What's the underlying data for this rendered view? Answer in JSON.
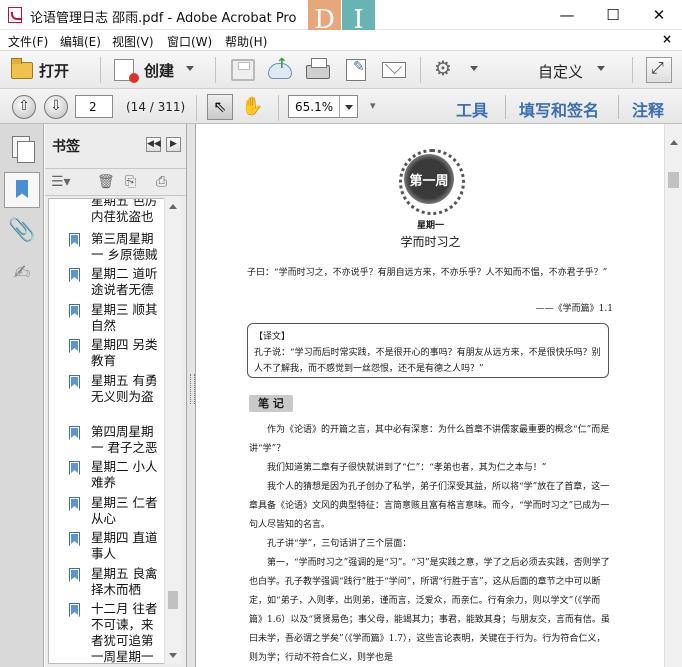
{
  "window": {
    "title": "论语管理日志 邵雨.pdf - Adobe Acrobat Pro",
    "logo_d": "D",
    "logo_i": "I",
    "minimize": "—",
    "maximize": "☐",
    "close": "✕"
  },
  "menu": {
    "items": [
      "文件(F)",
      "编辑(E)",
      "视图(V)",
      "窗口(W)",
      "帮助(H)"
    ],
    "close": "×"
  },
  "toolbar": {
    "open_label": "打开",
    "create_label": "创建",
    "customize_label": "自定义"
  },
  "nav": {
    "page_input": "2",
    "page_count": "(14 / 311)",
    "zoom": "65.1%",
    "more": "▾",
    "pane_tabs": [
      "工具",
      "填写和签名",
      "注释"
    ]
  },
  "bookmarks": {
    "title": "书签",
    "items": [
      "星期五 色厉内荏犹盗也",
      "第三周星期一 乡原德贼",
      "星期二 道听途说者无德",
      "星期三 顺其自然",
      "星期四 另类教育",
      "星期五 有勇无义则为盗",
      "第四周星期一 君子之恶",
      "星期二 小人难养",
      "星期三 仁者从心",
      "星期四 直道事人",
      "星期五 良禽择木而栖",
      "十二月 往者不可谏，来者犹可追第一周星期一"
    ]
  },
  "document": {
    "week_badge": "第一周",
    "day": "星期一",
    "title": "学而时习之",
    "quote": "子曰：“学而时习之，不亦说乎？有朋自远方来，不亦乐乎？人不知而不愠，不亦君子乎？”",
    "source": "——《学而篇》1.1",
    "translation": "【译文】\n孔子说：“学习而后时常实践，不是很开心的事吗？有朋友从远方来，不是很快乐吗？别人不了解我，而不感觉到一丝怨恨，还不是有德之人吗？”",
    "note_tag": "笔 记",
    "body": [
      "作为《论语》的开篇之言，其中必有深意：为什么首章不讲儒家最重要的概念“仁”而是讲“学”？",
      "我们知道第二章有子很快就讲到了“仁”：“孝弟也者，其为仁之本与！”",
      "我个人的猜想是因为孔子创办了私学，弟子们深受其益，所以将“学”放在了首章，这一章具备《论语》文风的典型特征：言简意赅且富有格言意味。而今，“学而时习之”已成为一句人尽皆知的名言。",
      "孔子讲“学”，三句话讲了三个层面：",
      "第一，“学而时习之”强调的是“习”。“习”是实践之意，学了之后必须去实践，否则学了也白学。孔子教学强调“践行”胜于“学问”，所谓“行胜于言”，这从后面的章节之中可以断定，如“弟子，入则孝，出则弟，谨而言，泛爱众，而亲仁。行有余力，则以学文”（《学而篇》1.6）以及“贤贤易色；事父母，能竭其力；事君，能致其身；与朋友交，言而有信。虽曰未学，吾必谓之学矣”（《学而篇》1.7），这些言论表明，关键在于行为。行为符合仁义，则为学；行动不符合仁义，则学也是"
    ]
  }
}
